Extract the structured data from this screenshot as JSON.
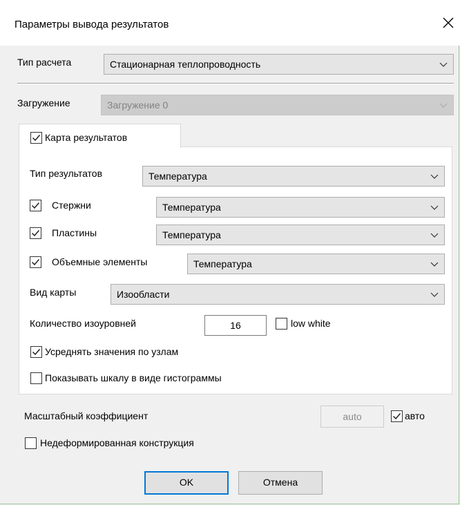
{
  "dialog": {
    "title": "Параметры вывода результатов",
    "close_icon": "close-icon"
  },
  "calc_type": {
    "label": "Тип расчета",
    "value": "Стационарная теплопроводность"
  },
  "loading": {
    "label": "Загружение",
    "value": "Загружение 0"
  },
  "results_map": {
    "tab_label": "Карта результатов",
    "tab_checked": true,
    "result_type": {
      "label": "Тип результатов",
      "value": "Температура"
    },
    "rods": {
      "label": "Стержни",
      "checked": true,
      "value": "Температура"
    },
    "plates": {
      "label": "Пластины",
      "checked": true,
      "value": "Температура"
    },
    "volume": {
      "label": "Объемные элементы",
      "checked": true,
      "value": "Температура"
    },
    "map_view": {
      "label": "Вид карты",
      "value": "Изообласти"
    },
    "isolevels": {
      "label": "Количество изоуровней",
      "value": "16"
    },
    "low_white": {
      "label": "low white",
      "checked": false
    },
    "average": {
      "label": "Усреднять значения по узлам",
      "checked": true
    },
    "histogram": {
      "label": "Показывать шкалу в виде гистограммы",
      "checked": false
    }
  },
  "scale": {
    "label": "Масштабный коэффициент",
    "value": "auto",
    "auto_label": "авто",
    "auto_checked": true
  },
  "undeformed": {
    "label": "Недеформированная конструкция",
    "checked": false
  },
  "buttons": {
    "ok": "OK",
    "cancel": "Отмена"
  },
  "colors": {
    "accent": "#0078d7",
    "panel": "#ffffff",
    "window": "#f0f0f0"
  }
}
